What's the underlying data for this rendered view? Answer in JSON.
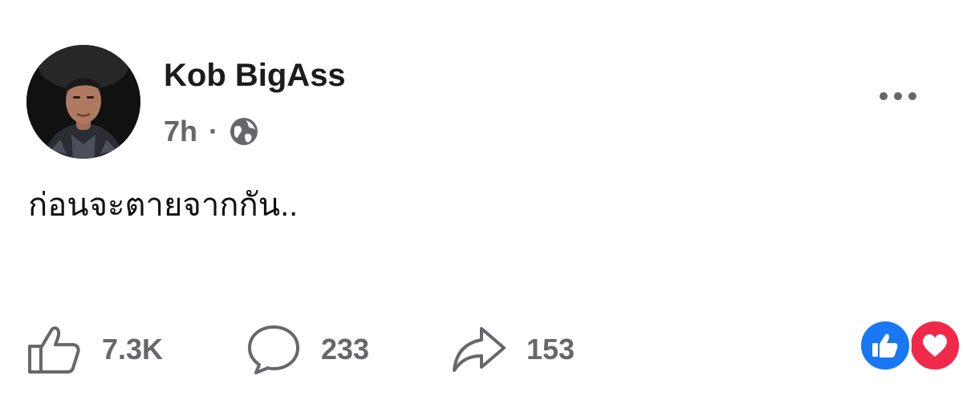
{
  "post": {
    "author": "Kob BigAss",
    "time": "7h",
    "separator": "·",
    "audience_icon": "globe-icon",
    "text": "ก่อนจะตายจากกัน..",
    "more_icon": "more-options-icon"
  },
  "actions": {
    "like": {
      "icon": "thumbs-up-icon",
      "count": "7.3K"
    },
    "comment": {
      "icon": "comment-bubble-icon",
      "count": "233"
    },
    "share": {
      "icon": "share-arrow-icon",
      "count": "153"
    }
  },
  "reactions": [
    {
      "icon": "like-reaction-icon",
      "color": "#1877f2"
    },
    {
      "icon": "love-reaction-icon",
      "color": "#f02849"
    }
  ],
  "colors": {
    "secondary_text": "#65676b",
    "like_blue": "#1877f2",
    "love_red": "#f02849"
  }
}
